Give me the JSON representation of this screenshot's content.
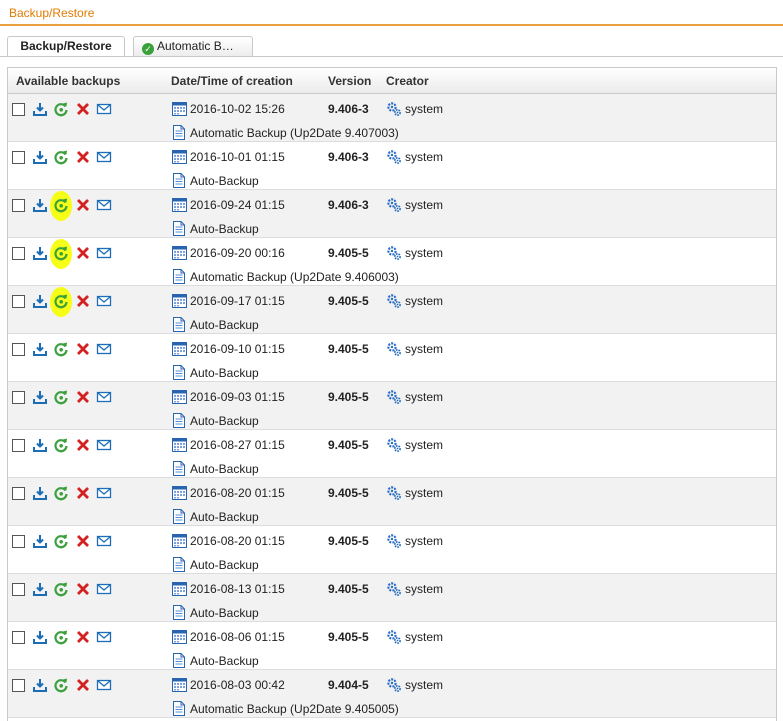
{
  "page": {
    "title": "Backup/Restore"
  },
  "tabs": [
    {
      "label": "Backup/Restore",
      "active": true
    },
    {
      "label": "Automatic B…",
      "active": false
    }
  ],
  "table": {
    "columns": [
      "Available backups",
      "Date/Time of creation",
      "Version",
      "Creator"
    ],
    "rows": [
      {
        "date": "2016-10-02 15:26",
        "version": "9.406-3",
        "creator": "system",
        "comment": "Automatic Backup (Up2Date 9.407003)",
        "highlight": false
      },
      {
        "date": "2016-10-01 01:15",
        "version": "9.406-3",
        "creator": "system",
        "comment": "Auto-Backup",
        "highlight": false
      },
      {
        "date": "2016-09-24 01:15",
        "version": "9.406-3",
        "creator": "system",
        "comment": "Auto-Backup",
        "highlight": true
      },
      {
        "date": "2016-09-20 00:16",
        "version": "9.405-5",
        "creator": "system",
        "comment": "Automatic Backup (Up2Date 9.406003)",
        "highlight": true
      },
      {
        "date": "2016-09-17 01:15",
        "version": "9.405-5",
        "creator": "system",
        "comment": "Auto-Backup",
        "highlight": true
      },
      {
        "date": "2016-09-10 01:15",
        "version": "9.405-5",
        "creator": "system",
        "comment": "Auto-Backup",
        "highlight": false
      },
      {
        "date": "2016-09-03 01:15",
        "version": "9.405-5",
        "creator": "system",
        "comment": "Auto-Backup",
        "highlight": false
      },
      {
        "date": "2016-08-27 01:15",
        "version": "9.405-5",
        "creator": "system",
        "comment": "Auto-Backup",
        "highlight": false
      },
      {
        "date": "2016-08-20 01:15",
        "version": "9.405-5",
        "creator": "system",
        "comment": "Auto-Backup",
        "highlight": false
      },
      {
        "date": "2016-08-20 01:15",
        "version": "9.405-5",
        "creator": "system",
        "comment": "Auto-Backup",
        "highlight": false
      },
      {
        "date": "2016-08-13 01:15",
        "version": "9.405-5",
        "creator": "system",
        "comment": "Auto-Backup",
        "highlight": false
      },
      {
        "date": "2016-08-06 01:15",
        "version": "9.405-5",
        "creator": "system",
        "comment": "Auto-Backup",
        "highlight": false
      },
      {
        "date": "2016-08-03 00:42",
        "version": "9.404-5",
        "creator": "system",
        "comment": "Automatic Backup (Up2Date 9.405005)",
        "highlight": false
      }
    ]
  },
  "icons": {
    "row_actions": [
      "download-icon",
      "restore-icon",
      "delete-icon",
      "mail-icon"
    ],
    "date": "calendar-icon",
    "creator": "gears-icon",
    "comment": "document-icon",
    "tab2": "check-circle-icon"
  },
  "colors": {
    "accent": "#e07b00",
    "download": "#1b6db8",
    "restore": "#3aa13a",
    "delete": "#d42020",
    "mail": "#1b6db8",
    "highlight": "#f6ff00"
  }
}
